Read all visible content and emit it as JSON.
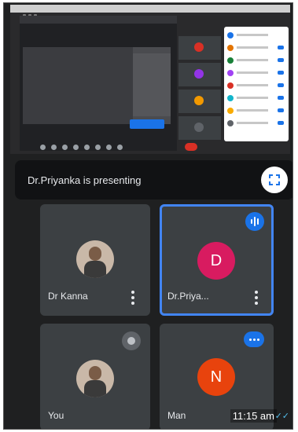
{
  "presenting_bar": {
    "text": "Dr.Priyanka is presenting"
  },
  "participants": [
    {
      "name": "Dr Kanna",
      "avatar_type": "photo"
    },
    {
      "name": "Dr.Priya...",
      "avatar_letter": "D",
      "avatar_color": "#d81b60",
      "status": "speaking"
    },
    {
      "name": "You",
      "avatar_type": "photo",
      "status": "muted"
    },
    {
      "name": "Man",
      "avatar_letter": "N",
      "avatar_color": "#e8430d",
      "status": "more-options"
    }
  ],
  "message_meta": {
    "time": "11:15 am",
    "read_status": "double-check"
  },
  "colors": {
    "accent": "#1a73e8",
    "tile_bg": "#3c4043",
    "app_bg": "#1f2021"
  },
  "icons": [
    "fullscreen-icon",
    "more-vert-icon",
    "audio-wave-icon",
    "mic-off-icon",
    "dots-icon",
    "double-check-icon"
  ]
}
